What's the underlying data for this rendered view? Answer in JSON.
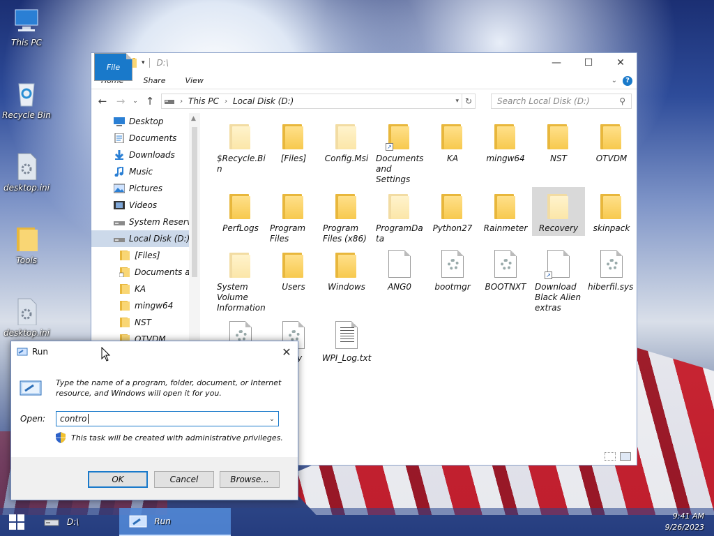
{
  "desktop": {
    "icons": [
      {
        "label": "This PC"
      },
      {
        "label": "Recycle Bin"
      },
      {
        "label": "desktop.ini"
      },
      {
        "label": "Tools"
      },
      {
        "label": "desktop.ini"
      }
    ]
  },
  "explorer": {
    "title": "D:\\",
    "ribbon_tabs": [
      "File",
      "Home",
      "Share",
      "View"
    ],
    "address": {
      "root": "This PC",
      "current": "Local Disk (D:)"
    },
    "search_placeholder": "Search Local Disk (D:)",
    "nav_items": [
      {
        "label": "Desktop",
        "icon": "desktop-icon"
      },
      {
        "label": "Documents",
        "icon": "documents-icon"
      },
      {
        "label": "Downloads",
        "icon": "downloads-icon"
      },
      {
        "label": "Music",
        "icon": "music-icon"
      },
      {
        "label": "Pictures",
        "icon": "pictures-icon"
      },
      {
        "label": "Videos",
        "icon": "videos-icon"
      },
      {
        "label": "System Reserved",
        "icon": "drive-icon"
      },
      {
        "label": "Local Disk (D:)",
        "icon": "drive-icon",
        "selected": true
      },
      {
        "label": "[Files]",
        "icon": "folder-icon"
      },
      {
        "label": "Documents and",
        "icon": "folder-shortcut-icon"
      },
      {
        "label": "KA",
        "icon": "folder-icon"
      },
      {
        "label": "mingw64",
        "icon": "folder-icon"
      },
      {
        "label": "NST",
        "icon": "folder-icon"
      },
      {
        "label": "OTVDM",
        "icon": "folder-icon"
      }
    ],
    "items": [
      {
        "label": "$Recycle.Bi\nn",
        "kind": "folder-faint"
      },
      {
        "label": "[Files]",
        "kind": "folder"
      },
      {
        "label": "Config.Msi",
        "kind": "folder-faint"
      },
      {
        "label": "Documents and Settings",
        "kind": "folder-shortcut"
      },
      {
        "label": "KA",
        "kind": "folder"
      },
      {
        "label": "mingw64",
        "kind": "folder"
      },
      {
        "label": "NST",
        "kind": "folder"
      },
      {
        "label": "OTVDM",
        "kind": "folder"
      },
      {
        "label": "PerfLogs",
        "kind": "folder"
      },
      {
        "label": "Program Files",
        "kind": "folder"
      },
      {
        "label": "Program Files (x86)",
        "kind": "folder"
      },
      {
        "label": "ProgramDa\nta",
        "kind": "folder-faint"
      },
      {
        "label": "Python27",
        "kind": "folder"
      },
      {
        "label": "Rainmeter",
        "kind": "folder"
      },
      {
        "label": "Recovery",
        "kind": "folder-faint",
        "selected": true
      },
      {
        "label": "skinpack",
        "kind": "folder"
      },
      {
        "label": "System Volume Information",
        "kind": "folder-faint"
      },
      {
        "label": "Users",
        "kind": "folder"
      },
      {
        "label": "Windows",
        "kind": "folder"
      },
      {
        "label": "ANG0",
        "kind": "file"
      },
      {
        "label": "bootmgr",
        "kind": "file-gear"
      },
      {
        "label": "BOOTNXT",
        "kind": "file-gear"
      },
      {
        "label": "Download Black Alien extras",
        "kind": "file-shortcut"
      },
      {
        "label": "hiberfil.sys",
        "kind": "file-gear"
      },
      {
        "label": "",
        "kind": "file-gear"
      },
      {
        "label": "e.sy",
        "kind": "file-gear"
      },
      {
        "label": "WPI_Log.txt",
        "kind": "text-file"
      }
    ]
  },
  "run_dialog": {
    "title": "Run",
    "description": "Type the name of a program, folder, document, or Internet resource, and Windows will open it for you.",
    "open_label": "Open:",
    "open_value": "contro",
    "admin_note": "This task will be created with administrative privileges.",
    "buttons": {
      "ok": "OK",
      "cancel": "Cancel",
      "browse": "Browse..."
    }
  },
  "taskbar": {
    "items": [
      {
        "label": "D:\\",
        "icon": "drive-icon"
      },
      {
        "label": "Run",
        "icon": "run-icon",
        "active": true
      }
    ],
    "time": "9:41 AM",
    "date": "9/26/2023"
  }
}
